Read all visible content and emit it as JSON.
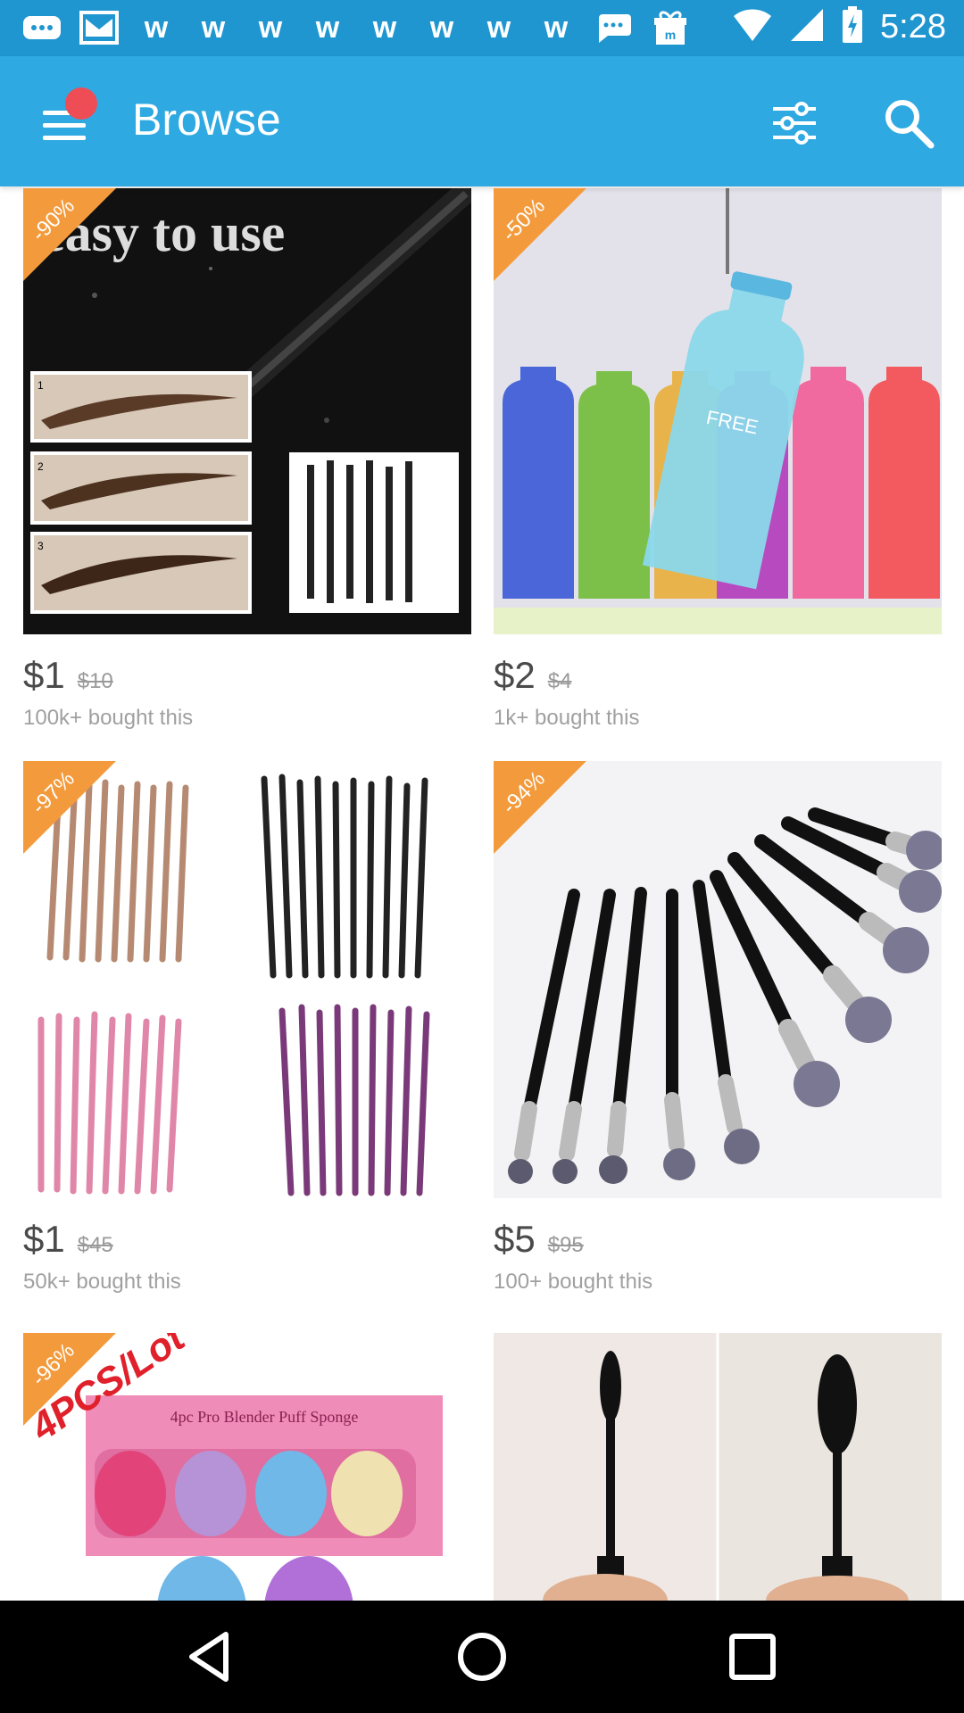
{
  "status_bar": {
    "time": "5:28",
    "icons": [
      "chat-icon",
      "mail-icon",
      "w-app-icon",
      "w-app-icon",
      "w-app-icon",
      "w-app-icon",
      "w-app-icon",
      "w-app-icon",
      "w-app-icon",
      "w-app-icon",
      "message-icon",
      "gift-icon",
      "wifi-icon",
      "signal-icon",
      "battery-icon"
    ]
  },
  "app_bar": {
    "title": "Browse"
  },
  "products": [
    {
      "discount": "-90%",
      "price": "$1",
      "old_price": "$10",
      "bought": "100k+ bought this",
      "image": "eyebrow-pencil"
    },
    {
      "discount": "-50%",
      "price": "$2",
      "old_price": "$4",
      "bought": "1k+ bought this",
      "image": "water-bottles"
    },
    {
      "discount": "-97%",
      "price": "$1",
      "old_price": "$45",
      "bought": "50k+ bought this",
      "image": "brush-sets"
    },
    {
      "discount": "-94%",
      "price": "$5",
      "old_price": "$95",
      "bought": "100+ bought this",
      "image": "kabuki-brushes"
    },
    {
      "discount": "-96%",
      "image_caption": "4PCS/Lot",
      "image": "blender-sponges"
    },
    {
      "image": "mascara"
    }
  ],
  "colors": {
    "status_bar": "#1f96d0",
    "app_bar": "#2fa9e1",
    "discount_badge": "#f39b3c",
    "notification_dot": "#ef4d55"
  }
}
